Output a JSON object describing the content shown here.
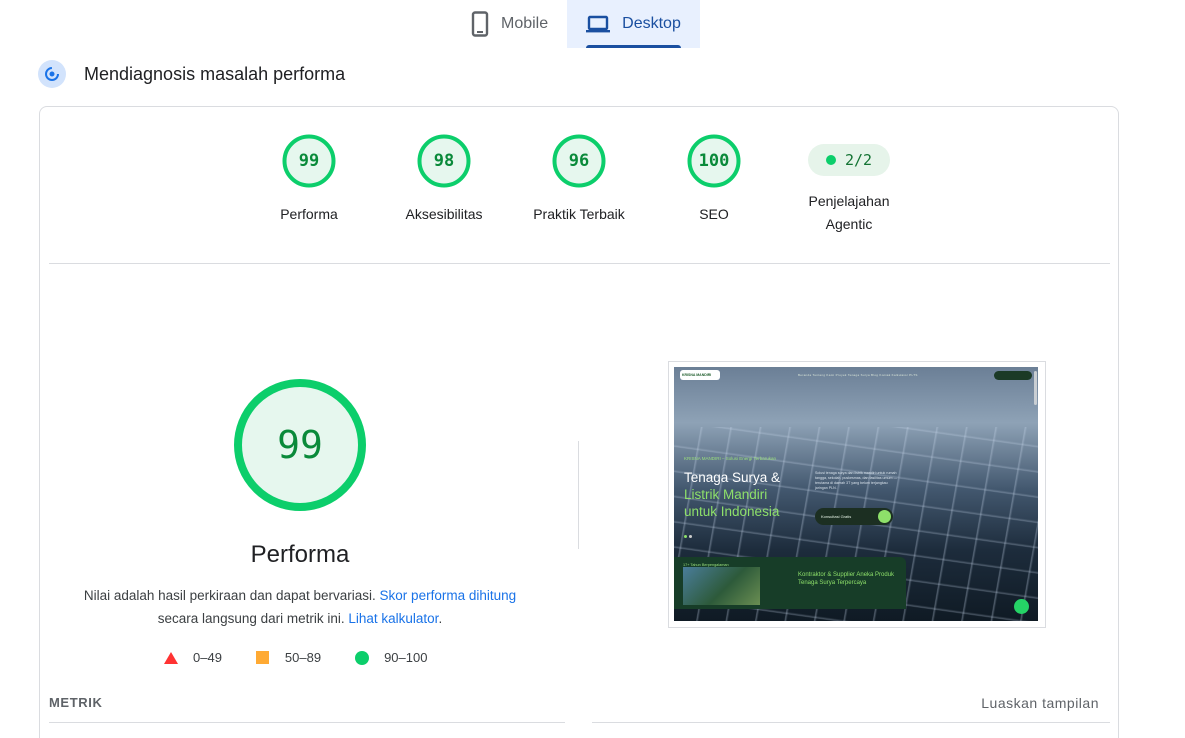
{
  "tabs": [
    {
      "label": "Mobile",
      "icon": "phone-icon",
      "active": false
    },
    {
      "label": "Desktop",
      "icon": "laptop-icon",
      "active": true
    }
  ],
  "diagnose": {
    "title": "Mendiagnosis masalah performa",
    "icon": "diagnose-gauge-icon"
  },
  "scores": [
    {
      "label": "Performa",
      "value": "99"
    },
    {
      "label": "Aksesibilitas",
      "value": "98"
    },
    {
      "label": "Praktik Terbaik",
      "value": "96"
    },
    {
      "label": "SEO",
      "value": "100"
    }
  ],
  "agentic": {
    "value": "2/2",
    "label_line1": "Penjelajahan",
    "label_line2": "Agentic"
  },
  "performance": {
    "score": "99",
    "title": "Performa",
    "desc_1": "Nilai adalah hasil perkiraan dan dapat bervariasi. ",
    "desc_link_1": "Skor performa dihitung",
    "desc_2": "secara langsung dari metrik ini. ",
    "desc_link_2": "Lihat kalkulator",
    "desc_3": "."
  },
  "legend": [
    {
      "range": "0–49",
      "shape": "triangle",
      "color": "#ff3333"
    },
    {
      "range": "50–89",
      "shape": "square",
      "color": "#ffaa33"
    },
    {
      "range": "90–100",
      "shape": "circle",
      "color": "#0cce6b"
    }
  ],
  "metrics": {
    "heading": "METRIK",
    "expand_label": "Luaskan tampilan"
  },
  "screenshot": {
    "logo_text": "KRISNA MANDIRI",
    "nav_links": "Beranda   Tentang Kami   Proyek Tenaga Surya   Blog   Kontak   Kalkulator PLTS",
    "eyebrow": "KRISNA MANDIRI – Solusi Energi Terbarukan",
    "headline_1": "Tenaga Surya &",
    "headline_2": "Listrik Mandiri",
    "headline_3": "untuk Indonesia",
    "paragraph": "Solusi tenaga surya dan listrik mandiri untuk rumah tangga, sekolah, puskesmas, dan fasilitas umum — terutama di daerah 3T yang belum terjangkau jaringan PLN.",
    "cta": "Konsultasi Gratis",
    "badge": "17+ Tahun Berpengalaman",
    "bottom_1": "Kontraktor & Supplier",
    "bottom_2": " Aneka Produk Tenaga Surya Terpercaya"
  },
  "colors": {
    "pass": "#0cce6b",
    "pass_text": "#0a8a3a",
    "pass_bg": "#e6f4ea",
    "accent": "#1a4fa0"
  }
}
